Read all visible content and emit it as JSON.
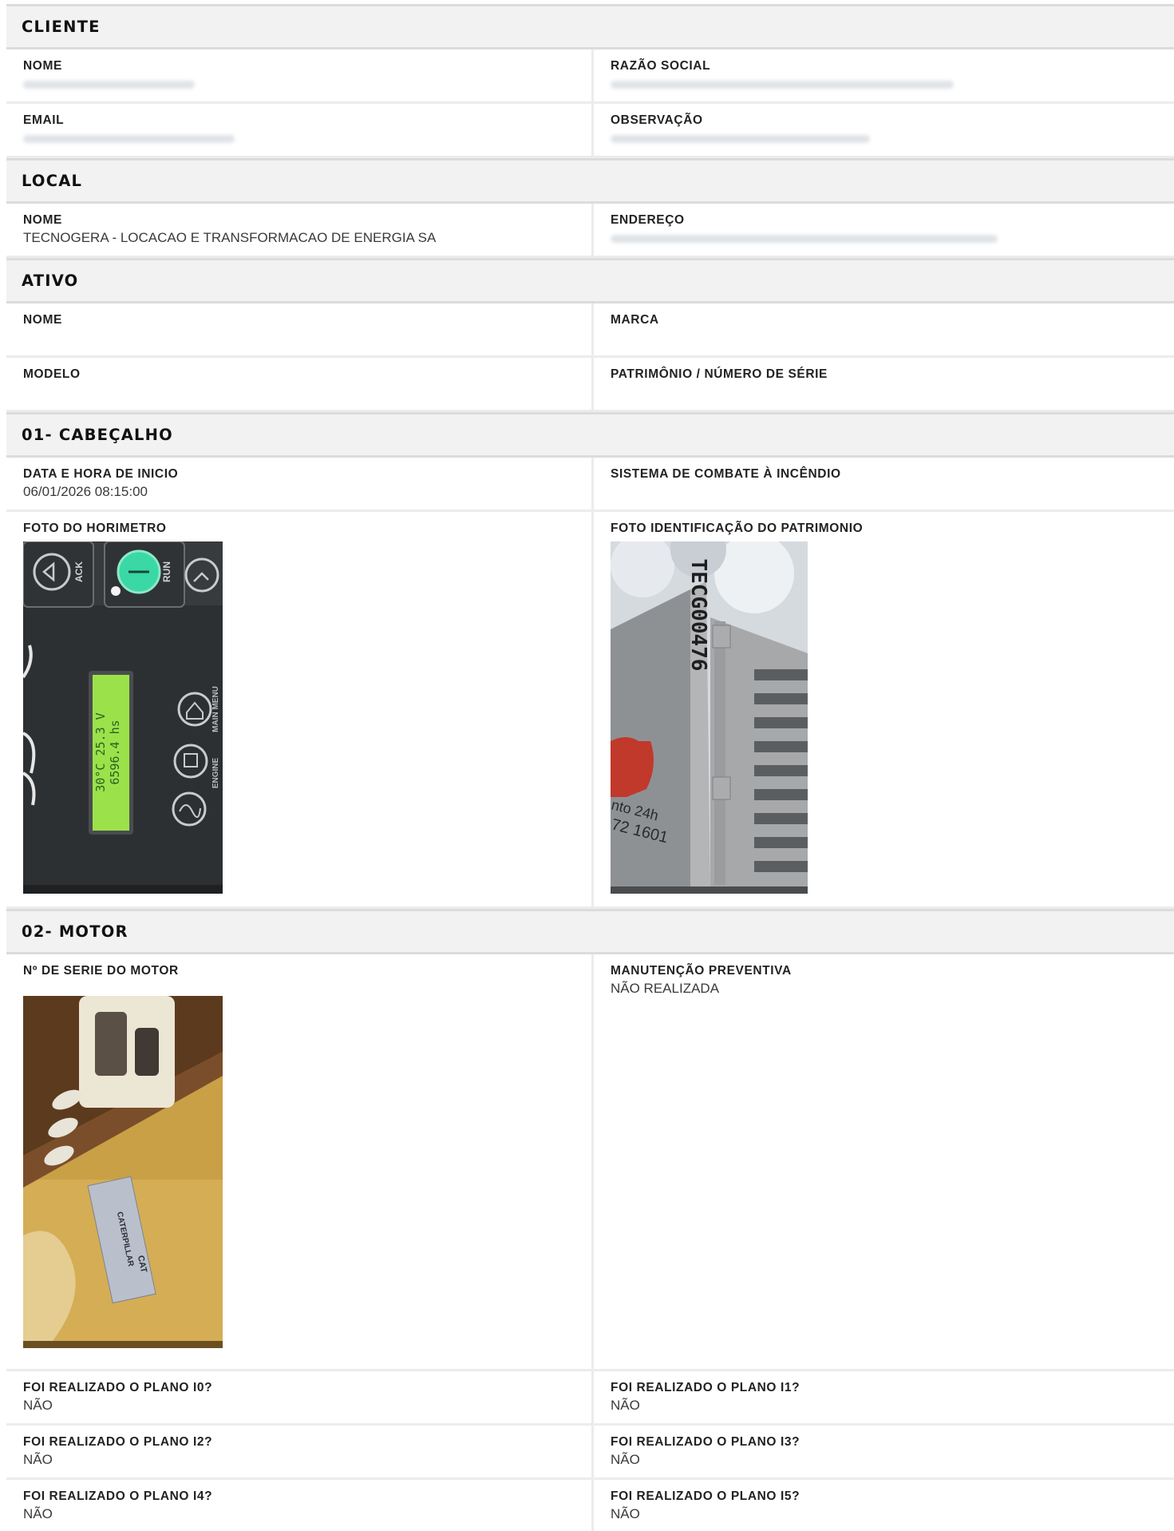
{
  "sections": {
    "cliente": {
      "title": "CLIENTE"
    },
    "local": {
      "title": "LOCAL"
    },
    "ativo": {
      "title": "ATIVO"
    },
    "cabecalho": {
      "title": "01- CABEÇALHO"
    },
    "motor": {
      "title": "02- MOTOR"
    }
  },
  "cliente": {
    "nome_label": "NOME",
    "razao_label": "RAZÃO SOCIAL",
    "email_label": "EMAIL",
    "obs_label": "OBSERVAÇÃO"
  },
  "local": {
    "nome_label": "NOME",
    "nome_value": "TECNOGERA - LOCACAO E TRANSFORMACAO DE ENERGIA SA",
    "endereco_label": "ENDEREÇO"
  },
  "ativo": {
    "nome_label": "NOME",
    "marca_label": "MARCA",
    "modelo_label": "MODELO",
    "patrimonio_label": "PATRIMÔNIO / NÚMERO DE SÉRIE"
  },
  "cabecalho": {
    "data_label": "DATA E HORA DE INICIO",
    "data_value": "06/01/2026 08:15:00",
    "sistema_label": "SISTEMA DE COMBATE À INCÊNDIO",
    "foto_horimetro_label": "FOTO DO HORIMETRO",
    "foto_patrimonio_label": "FOTO IDENTIFICAÇÃO DO PATRIMONIO"
  },
  "horimetro_photo": {
    "ack": "ACK",
    "run": "RUN",
    "lcd_line1": "30°C 25.3 V",
    "lcd_line2": "6596.4 hs",
    "main_menu": "MAIN MENU",
    "engine": "ENGINE"
  },
  "patrimonio_photo": {
    "stencil": "TECG00476",
    "phone_line1": "nto 24h",
    "phone_line2": "72 1601"
  },
  "motor": {
    "serie_label": "Nº DE SERIE DO MOTOR",
    "manut_label": "MANUTENÇÃO PREVENTIVA",
    "manut_value": "NÃO REALIZADA",
    "plano_i0_label": "FOI REALIZADO O PLANO I0?",
    "plano_i0_value": "NÃO",
    "plano_i1_label": "FOI REALIZADO O PLANO I1?",
    "plano_i1_value": "NÃO",
    "plano_i2_label": "FOI REALIZADO O PLANO I2?",
    "plano_i2_value": "NÃO",
    "plano_i3_label": "FOI REALIZADO O PLANO I3?",
    "plano_i3_value": "NÃO",
    "plano_i4_label": "FOI REALIZADO O PLANO I4?",
    "plano_i4_value": "NÃO",
    "plano_i5_label": "FOI REALIZADO O PLANO I5?",
    "plano_i5_value": "NÃO"
  },
  "motor_photo": {
    "plate_brand": "CATERPILLAR",
    "plate_logo": "CAT"
  }
}
